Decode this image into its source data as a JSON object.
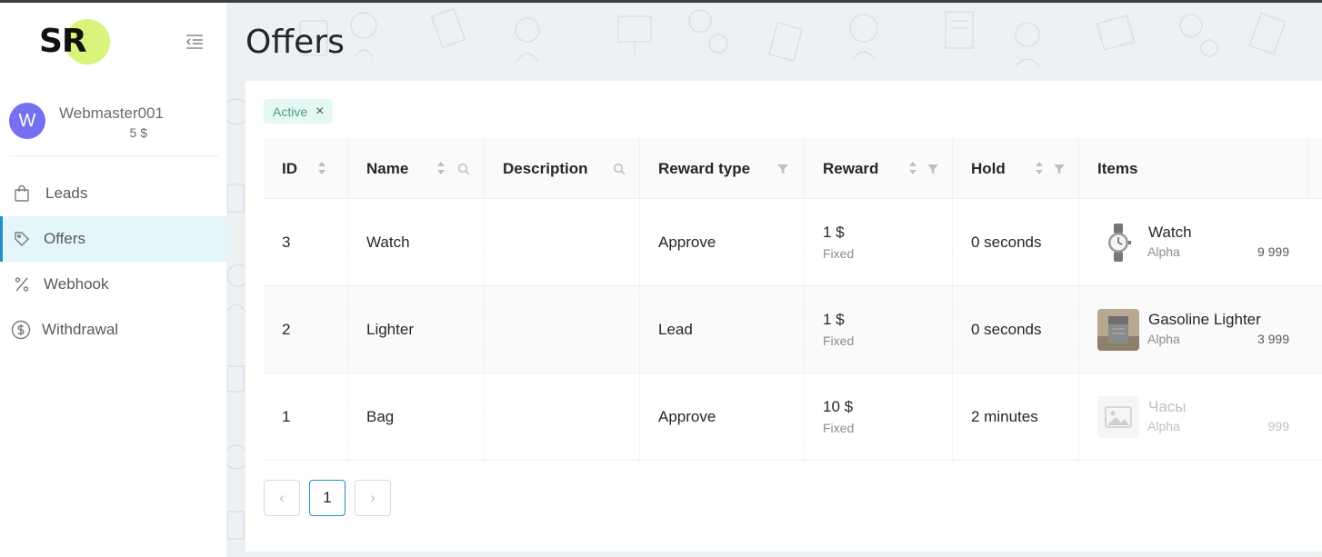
{
  "brand": {
    "logo_text": "SR",
    "accent": "#d9f47a"
  },
  "user": {
    "initial": "W",
    "name": "Webmaster001",
    "balance": "5 $"
  },
  "nav": [
    {
      "label": "Leads",
      "icon": "shopping-bag-icon"
    },
    {
      "label": "Offers",
      "icon": "tag-icon",
      "active": true
    },
    {
      "label": "Webhook",
      "icon": "percent-icon"
    },
    {
      "label": "Withdrawal",
      "icon": "dollar-circle-icon"
    }
  ],
  "page": {
    "title": "Offers"
  },
  "filter": {
    "label": "Active",
    "close": "×"
  },
  "table": {
    "columns": [
      "ID",
      "Name",
      "Description",
      "Reward type",
      "Reward",
      "Hold",
      "Items"
    ],
    "rows": [
      {
        "id": "3",
        "name": "Watch",
        "description": "",
        "reward_type": "Approve",
        "reward": "1 $",
        "reward_kind": "Fixed",
        "hold": "0 seconds",
        "item_name": "Watch",
        "item_sub": "Alpha",
        "item_qty": "9 999"
      },
      {
        "id": "2",
        "name": "Lighter",
        "description": "",
        "reward_type": "Lead",
        "reward": "1 $",
        "reward_kind": "Fixed",
        "hold": "0 seconds",
        "item_name": "Gasoline Lighter",
        "item_sub": "Alpha",
        "item_qty": "3 999"
      },
      {
        "id": "1",
        "name": "Bag",
        "description": "",
        "reward_type": "Approve",
        "reward": "10 $",
        "reward_kind": "Fixed",
        "hold": "2 minutes",
        "item_name": "Часы",
        "item_sub": "Alpha",
        "item_qty": "999"
      }
    ]
  },
  "pagination": {
    "prev": "‹",
    "current": "1",
    "next": "›"
  }
}
